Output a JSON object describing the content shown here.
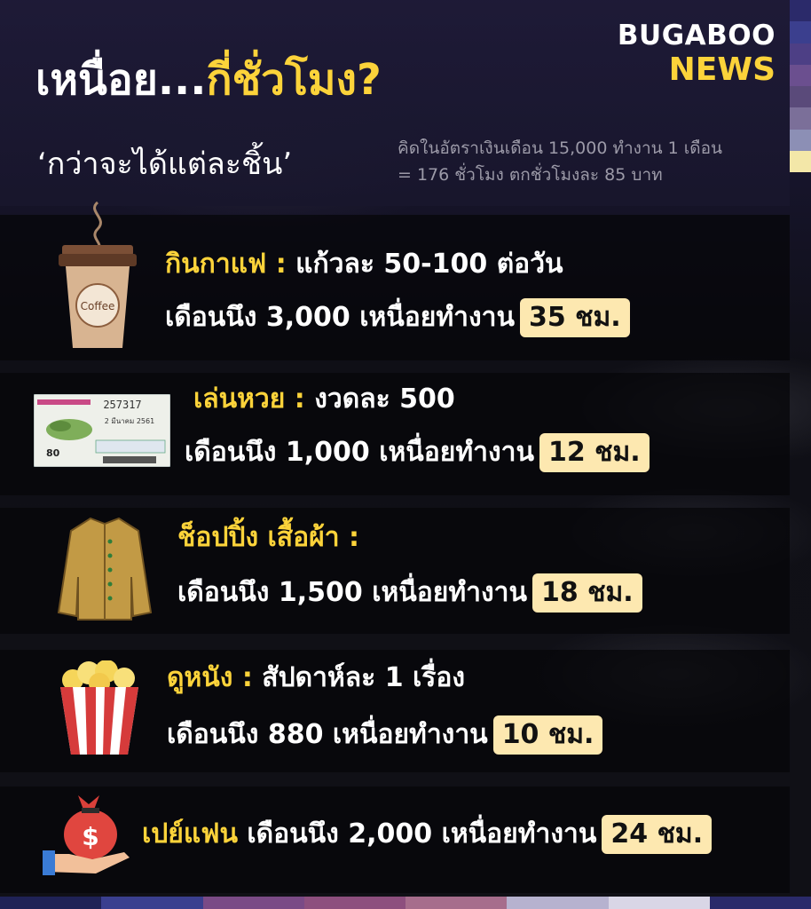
{
  "brand": {
    "line1": "BUGABOO",
    "line2": "NEWS"
  },
  "header": {
    "title_part1": "เหนื่อย...",
    "title_part2": "กี่ชั่วโมง?",
    "subtitle": "‘กว่าจะได้แต่ละชิ้น’",
    "note_line1": "คิดในอัตราเงินเดือน 15,000 ทำงาน 1 เดือน",
    "note_line2": "= 176 ชั่วโมง ตกชั่วโมงละ 85 บาท"
  },
  "items": [
    {
      "icon": "coffee-cup-icon",
      "icon_text": "Coffee",
      "category": "กินกาแฟ :",
      "detail": " แก้วละ 50-100 ต่อวัน",
      "line2": "เดือนนึง 3,000 เหนื่อยทำงาน",
      "hours": "35 ชม."
    },
    {
      "icon": "lottery-ticket-icon",
      "ticket_number": "257317",
      "ticket_date": "2 มีนาคม 2561",
      "ticket_price": "80",
      "category": "เล่นหวย :",
      "detail": " งวดละ 500",
      "line2": "เดือนนึง 1,000 เหนื่อยทำงาน",
      "hours": "12 ชม."
    },
    {
      "icon": "jacket-icon",
      "category": "ช็อปปิ้ง เสื้อผ้า :",
      "detail": "",
      "line2": "เดือนนึง 1,500 เหนื่อยทำงาน",
      "hours": "18 ชม."
    },
    {
      "icon": "popcorn-icon",
      "category": "ดูหนัง :",
      "detail": " สัปดาห์ละ 1 เรื่อง",
      "line2": "เดือนนึง 880 เหนื่อยทำงาน",
      "hours": "10 ชม."
    },
    {
      "icon": "money-bag-hand-icon",
      "category": "เปย์แฟน",
      "line2": " เดือนนึง 2,000 เหนื่อยทำงาน",
      "hours": "24 ชม."
    }
  ],
  "colors": {
    "accent_yellow": "#fcd33a",
    "badge_bg": "#fde8b0",
    "strip": [
      "#2b2a6a",
      "#3b3f8e",
      "#4d3f85",
      "#6b4f8f",
      "#5a4a7a",
      "#7b6f99",
      "#8c8fb5",
      "#f3e7a8"
    ],
    "bottom_bar": [
      "#1f2256",
      "#3a3f8f",
      "#7a4a86",
      "#8d4f7e",
      "#a66d8c",
      "#b6b2cf",
      "#d9d6e6",
      "#2a2a6a"
    ]
  }
}
